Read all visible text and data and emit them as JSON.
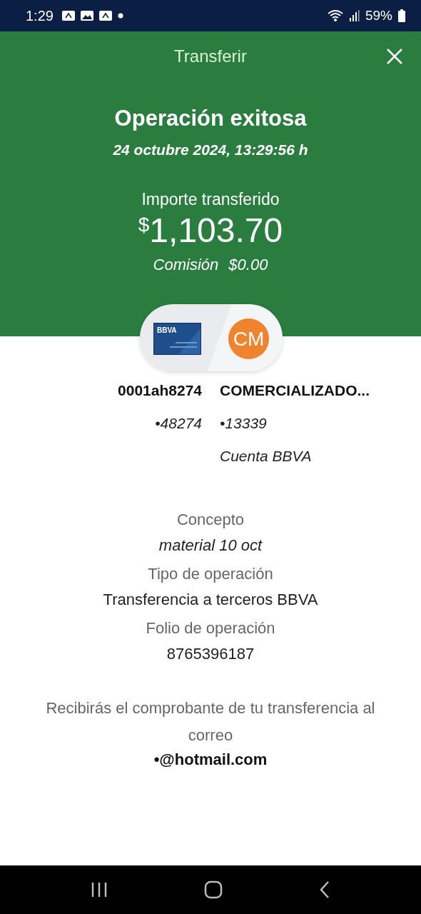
{
  "status_bar": {
    "time": "1:29",
    "battery": "59%"
  },
  "header": {
    "title": "Transferir"
  },
  "result": {
    "title": "Operación exitosa",
    "date": "24 octubre 2024, 13:29:56 h",
    "amount_label": "Importe transferido",
    "currency": "$",
    "amount": "1,103.70",
    "commission_label": "Comisión",
    "commission": "$0.00"
  },
  "transfer": {
    "card_logo": "BBVA",
    "avatar": "CM",
    "from": {
      "name": "0001ah8274",
      "account": "•48274"
    },
    "to": {
      "name": "COMERCIALIZADO...",
      "account": "•13339",
      "bank": "Cuenta BBVA"
    }
  },
  "details": [
    {
      "label": "Concepto",
      "value": "material 10 oct",
      "kind": "italic"
    },
    {
      "label": "Tipo de operación",
      "value": "Transferencia a terceros BBVA",
      "kind": "plain"
    },
    {
      "label": "Folio de operación",
      "value": "8765396187",
      "kind": "plain"
    }
  ],
  "notice": {
    "text": "Recibirás el comprobante de tu transferencia al correo",
    "email": "•@hotmail.com"
  }
}
